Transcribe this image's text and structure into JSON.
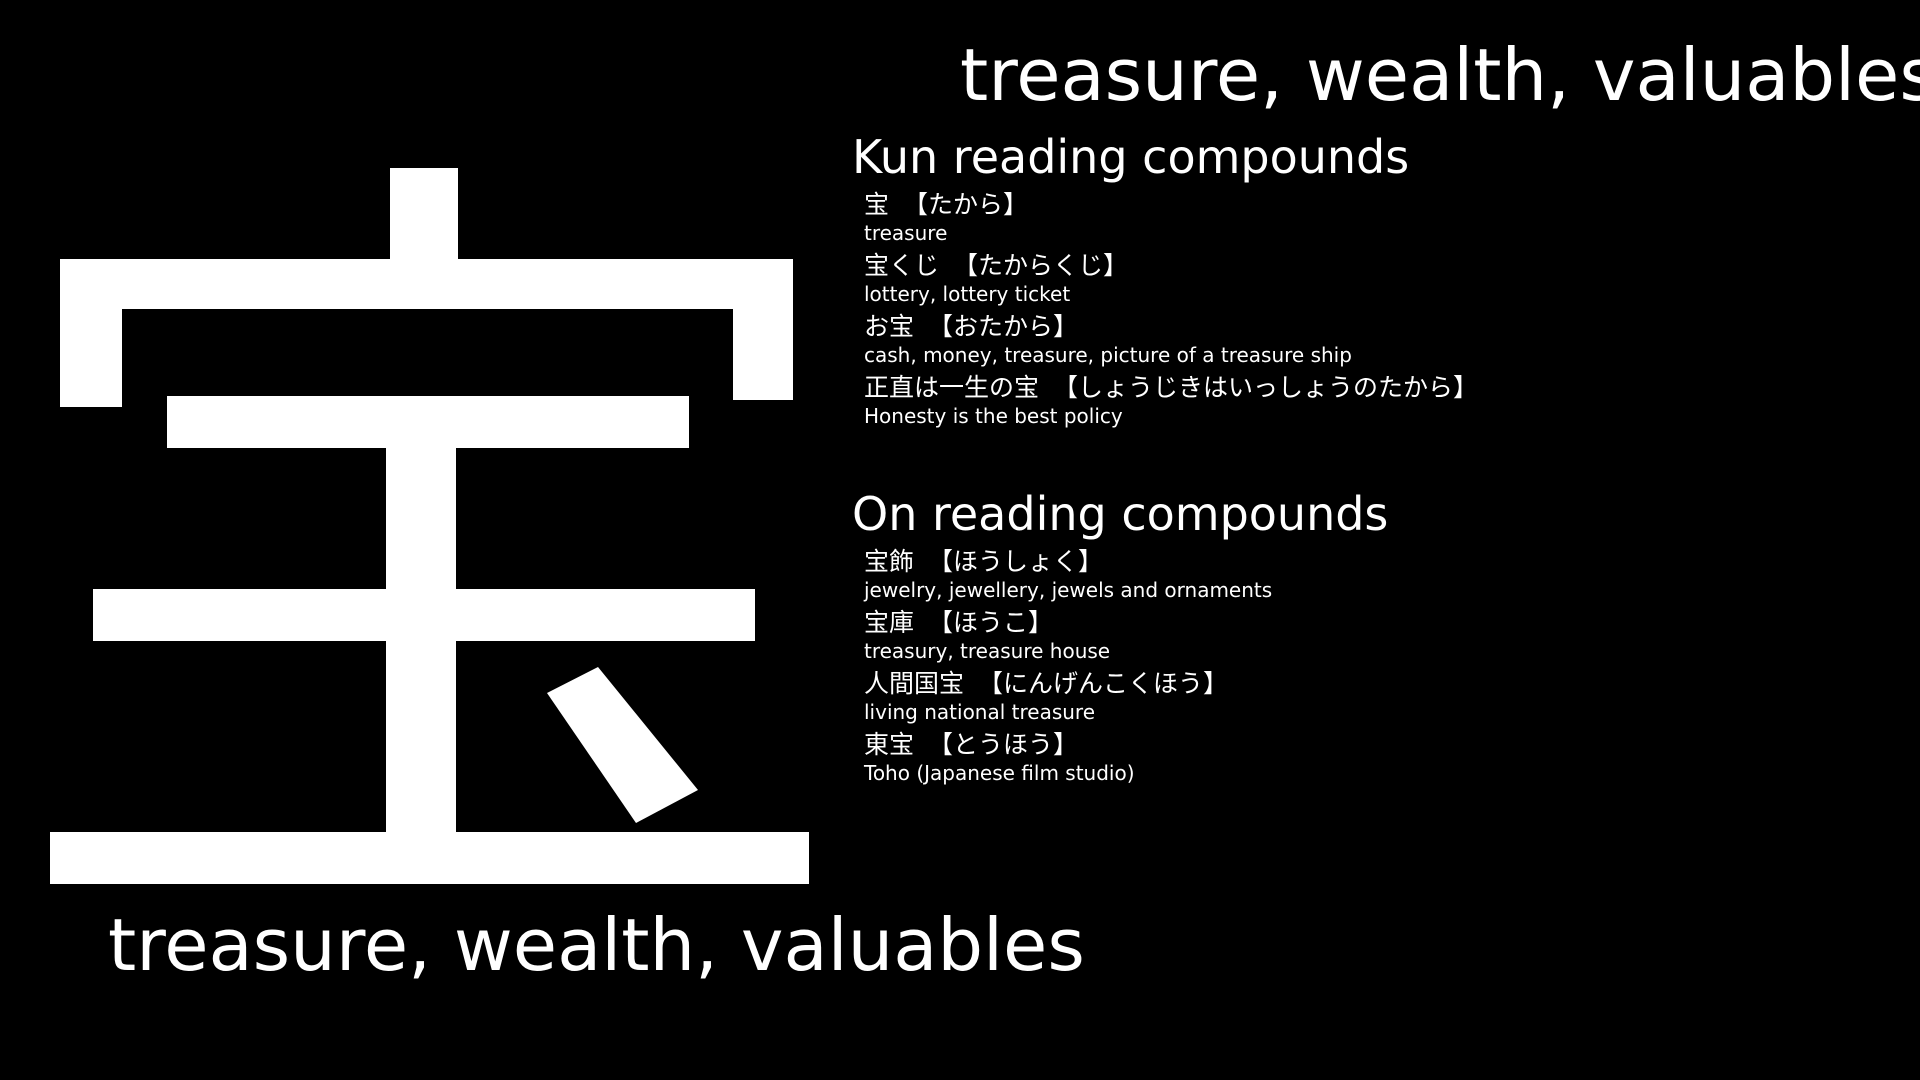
{
  "kanji": {
    "character": "宝"
  },
  "meaning_top": "treasure, wealth, valuables",
  "meaning_bottom": "treasure, wealth, valuables",
  "kun_section": {
    "title": "Kun reading compounds",
    "items": [
      {
        "word": "宝",
        "reading": "【たから】",
        "meaning": "treasure"
      },
      {
        "word": "宝くじ",
        "reading": "【たからくじ】",
        "meaning": "lottery, lottery ticket"
      },
      {
        "word": "お宝",
        "reading": "【おたから】",
        "meaning": "cash, money, treasure, picture of a treasure ship"
      },
      {
        "word": "正直は一生の宝",
        "reading": "【しょうじきはいっしょうのたから】",
        "meaning": "Honesty is the best policy"
      }
    ]
  },
  "on_section": {
    "title": "On reading compounds",
    "items": [
      {
        "word": "宝飾",
        "reading": "【ほうしょく】",
        "meaning": "jewelry, jewellery, jewels and ornaments"
      },
      {
        "word": "宝庫",
        "reading": "【ほうこ】",
        "meaning": "treasury, treasure house"
      },
      {
        "word": "人間国宝",
        "reading": "【にんげんこくほう】",
        "meaning": "living national treasure"
      },
      {
        "word": "東宝",
        "reading": "【とうほう】",
        "meaning": "Toho (Japanese film studio)"
      }
    ]
  }
}
